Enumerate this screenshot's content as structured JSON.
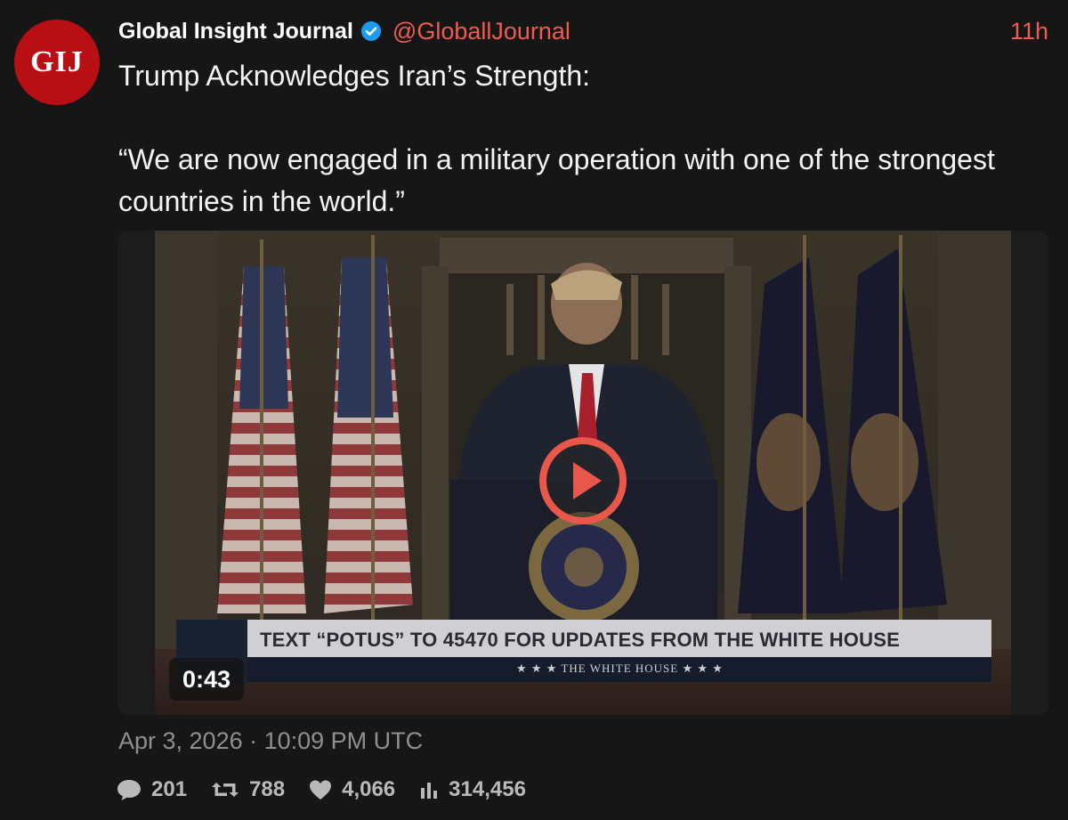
{
  "author": {
    "avatar_text": "GIJ",
    "display_name": "Global Insight Journal",
    "handle": "@GloballJournal",
    "verified_icon": "verified-badge-icon"
  },
  "post": {
    "time_ago": "11h",
    "line1": "Trump Acknowledges Iran’s Strength:",
    "line2": "“We are now engaged in a military operation with one of the strongest countries in the world.”",
    "timestamp": "Apr 3, 2026 · 10:09 PM UTC"
  },
  "video": {
    "duration": "0:43",
    "lower_third": "TEXT “POTUS” TO 45470 FOR UPDATES FROM THE WHITE HOUSE",
    "lower_third_sub": "★ ★ ★   THE WHITE HOUSE   ★ ★ ★"
  },
  "stats": {
    "replies": "201",
    "reposts": "788",
    "likes": "4,066",
    "views": "314,456"
  },
  "colors": {
    "background": "#161616",
    "accent": "#ef5b4c",
    "avatar": "#b80f14",
    "verified": "#1d9bf0",
    "muted": "#8f8f8f"
  }
}
